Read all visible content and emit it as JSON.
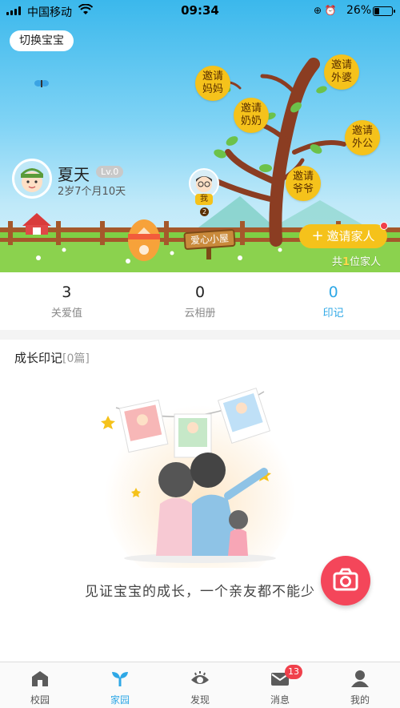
{
  "status_bar": {
    "carrier": "中国移动",
    "time": "09:34",
    "battery": "26%"
  },
  "header": {
    "switch_label": "切换宝宝"
  },
  "baby": {
    "name": "夏天",
    "level": "Lv.0",
    "age": "2岁7个月10天"
  },
  "tree": {
    "invites": [
      {
        "line1": "邀请",
        "line2": "妈妈"
      },
      {
        "line1": "邀请",
        "line2": "外婆"
      },
      {
        "line1": "邀请",
        "line2": "奶奶"
      },
      {
        "line1": "邀请",
        "line2": "外公"
      },
      {
        "line1": "邀请",
        "line2": "爷爷"
      }
    ],
    "me_label": "我",
    "me_count": "2",
    "house_sign": "爱心小屋"
  },
  "family": {
    "invite_button": "邀请家人",
    "count_prefix": "共",
    "count": "1",
    "count_suffix": "位家人"
  },
  "stats": [
    {
      "value": "3",
      "label": "关爱值"
    },
    {
      "value": "0",
      "label": "云相册"
    },
    {
      "value": "0",
      "label": "印记"
    }
  ],
  "growth": {
    "title": "成长印记",
    "count_note": "[0篇]",
    "caption": "见证宝宝的成长，一个亲友都不能少"
  },
  "tabbar": {
    "items": [
      {
        "label": "校园"
      },
      {
        "label": "家园"
      },
      {
        "label": "发现"
      },
      {
        "label": "消息",
        "badge": "13"
      },
      {
        "label": "我的"
      }
    ],
    "active_color": "#2fa8e6"
  },
  "colors": {
    "accent_yellow": "#f5c21b",
    "camera_red": "#f4465a",
    "sky_blue": "#3bb8ec"
  }
}
